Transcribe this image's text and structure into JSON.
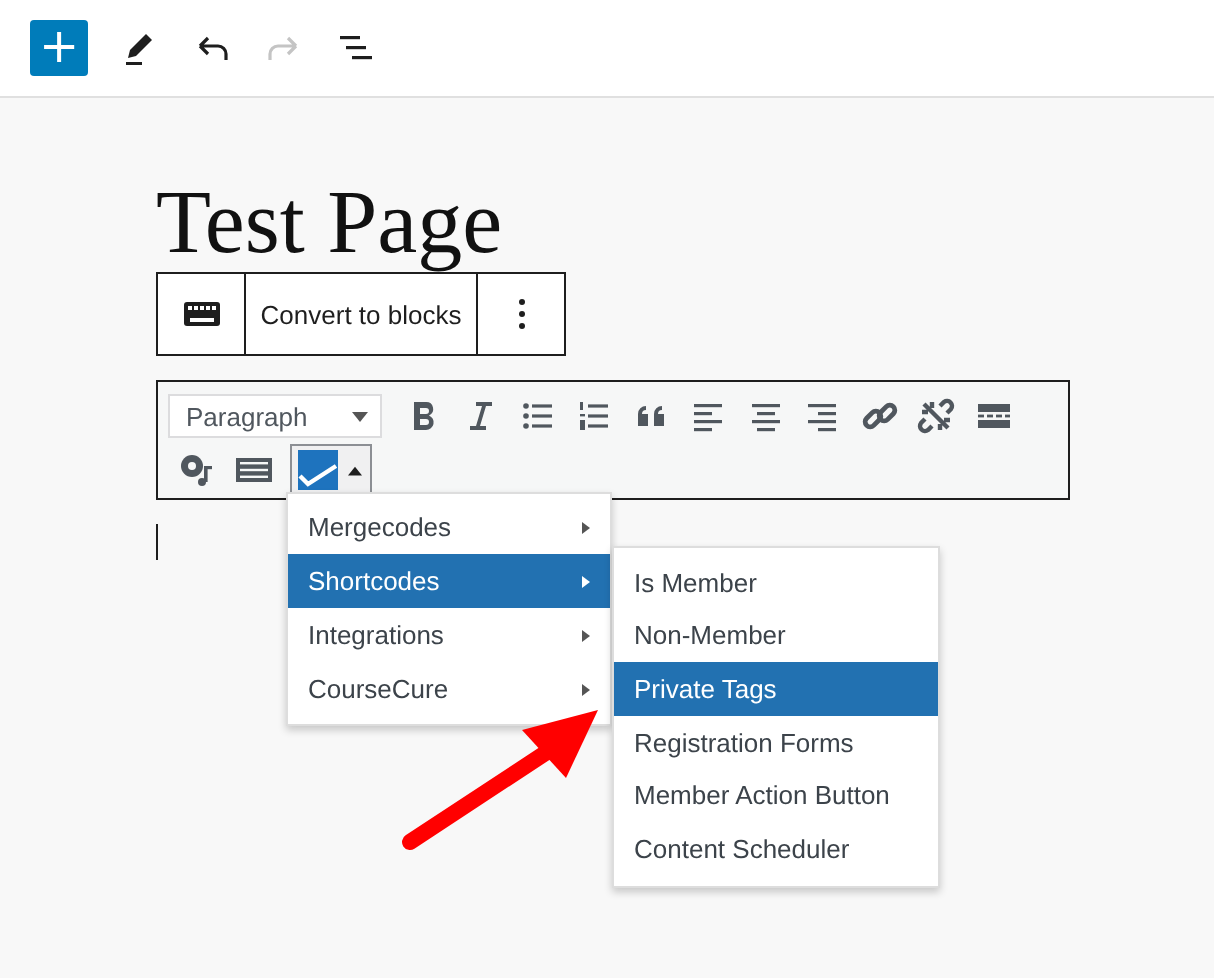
{
  "top_toolbar": {
    "add_button": "+"
  },
  "page_title": "Test Page",
  "block_toolbar": {
    "convert_button": "Convert to blocks"
  },
  "classic_toolbar": {
    "format_select": "Paragraph"
  },
  "dropdown_menu": {
    "items": [
      {
        "label": "Mergecodes",
        "selected": false,
        "has_submenu": true
      },
      {
        "label": "Shortcodes",
        "selected": true,
        "has_submenu": true
      },
      {
        "label": "Integrations",
        "selected": false,
        "has_submenu": true
      },
      {
        "label": "CourseCure",
        "selected": false,
        "has_submenu": true
      }
    ]
  },
  "submenu": {
    "items": [
      {
        "label": "Is Member",
        "selected": false
      },
      {
        "label": "Non-Member",
        "selected": false
      },
      {
        "label": "Private Tags",
        "selected": true
      },
      {
        "label": "Registration Forms",
        "selected": false
      },
      {
        "label": "Member Action Button",
        "selected": false
      },
      {
        "label": "Content Scheduler",
        "selected": false
      }
    ]
  }
}
